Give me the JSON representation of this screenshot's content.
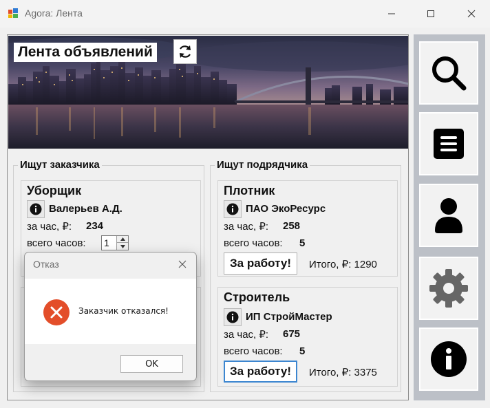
{
  "window": {
    "title": "Agora: Лента",
    "icon": "app-windows-icon"
  },
  "feed": {
    "title": "Лента объявлений",
    "refresh_icon": "refresh-icon"
  },
  "columns": {
    "left_title": "Ищут заказчика",
    "right_title": "Ищут подрядчика"
  },
  "labels": {
    "per_hour": "за час, ₽:",
    "total_hours": "всего часов:",
    "take_button": "За работу!",
    "total_prefix": "Итого, ₽:"
  },
  "left_cards": [
    {
      "title": "Уборщик",
      "party": "Валерьев А.Д.",
      "rate": "234",
      "hours": "1"
    }
  ],
  "right_cards": [
    {
      "title": "Плотник",
      "party": "ПАО ЭкоРесурс",
      "rate": "258",
      "hours": "5",
      "total": "1290"
    },
    {
      "title": "Строитель",
      "party": "ИП СтройМастер",
      "rate": "675",
      "hours": "5",
      "total": "3375"
    }
  ],
  "sidebar": {
    "items": [
      "search-icon",
      "list-icon",
      "user-icon",
      "settings-icon",
      "info-icon"
    ]
  },
  "dialog": {
    "title": "Отказ",
    "message": "Заказчик отказался!",
    "ok_label": "OK",
    "icon": "error-icon"
  },
  "colors": {
    "sidebar_bg": "#bcc0c7",
    "error_icon": "#e34e2a",
    "focus_border": "#3c86d0"
  }
}
